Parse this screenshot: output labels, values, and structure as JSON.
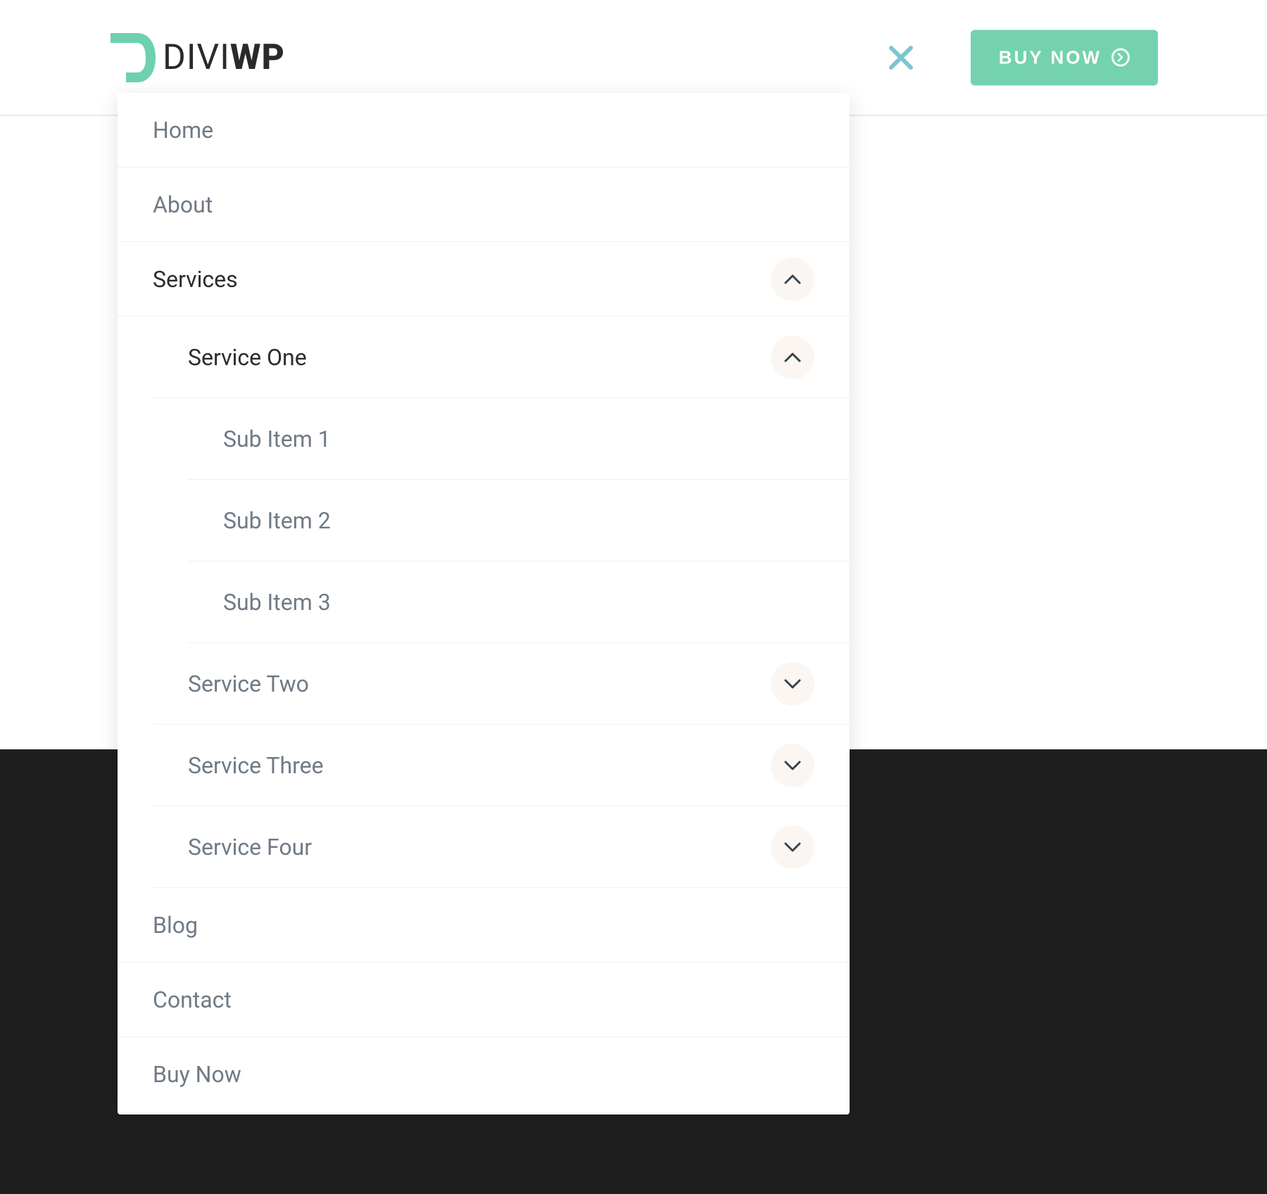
{
  "brand": {
    "part1": "DIVI",
    "part2": "WP",
    "accent_color": "#6ed0ae"
  },
  "header": {
    "buy_label": "BUY NOW"
  },
  "menu": {
    "items": [
      {
        "label": "Home"
      },
      {
        "label": "About"
      },
      {
        "label": "Services",
        "expanded": true
      },
      {
        "label": "Blog"
      },
      {
        "label": "Contact"
      },
      {
        "label": "Buy Now"
      }
    ],
    "services": {
      "items": [
        {
          "label": "Service One",
          "expanded": true
        },
        {
          "label": "Service Two",
          "expanded": false
        },
        {
          "label": "Service Three",
          "expanded": false
        },
        {
          "label": "Service Four",
          "expanded": false
        }
      ],
      "service_one_sub": [
        {
          "label": "Sub Item 1"
        },
        {
          "label": "Sub Item 2"
        },
        {
          "label": "Sub Item 3"
        }
      ]
    }
  }
}
